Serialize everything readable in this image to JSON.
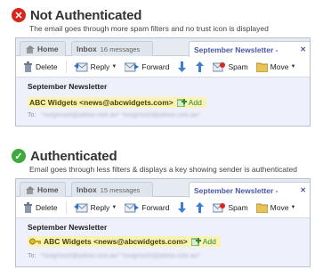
{
  "sections": [
    {
      "status": "bad",
      "status_glyph": "✕",
      "title": "Not Authenticated",
      "caption": "The email goes through more spam filters and no trust icon is displayed",
      "client": {
        "tabs": {
          "home": "Home",
          "inbox": "Inbox",
          "inbox_count": "16 messages",
          "active": "September Newsletter -",
          "close": "✕"
        },
        "toolbar": {
          "delete": "Delete",
          "reply": "Reply",
          "forward": "Forward",
          "spam": "Spam",
          "move": "Move"
        },
        "message": {
          "subject": "September Newsletter",
          "from": "ABC Widgets <news@abcwidgets.com>",
          "add": "Add",
          "to_label": "To:",
          "to_value": "*ourgrnuch@yahoo.com.au*  *ourgrnuch@yahoo.com.au*"
        },
        "key_icon": false
      }
    },
    {
      "status": "good",
      "status_glyph": "✓",
      "title": "Authenticated",
      "caption": "Email goes through less filters & displays a key showing sender is authenticated",
      "client": {
        "tabs": {
          "home": "Home",
          "inbox": "Inbox",
          "inbox_count": "15 messages",
          "active": "September Newsletter -",
          "close": "✕"
        },
        "toolbar": {
          "delete": "Delete",
          "reply": "Reply",
          "forward": "Forward",
          "spam": "Spam",
          "move": "Move"
        },
        "message": {
          "subject": "September Newsletter",
          "from": "ABC Widgets <news@abcwidgets.com>",
          "add": "Add",
          "to_label": "To:",
          "to_value": "*ourgrnuch@yahoo.com.au*  *ourgrnuch@yahoo.com.au*"
        },
        "key_icon": true
      }
    }
  ],
  "colors": {
    "bad": "#d9261c",
    "good": "#3faa3c",
    "active_tab": "#4a56a8",
    "highlight": "#f8f2b4",
    "message_bg": "#eef0fb"
  }
}
